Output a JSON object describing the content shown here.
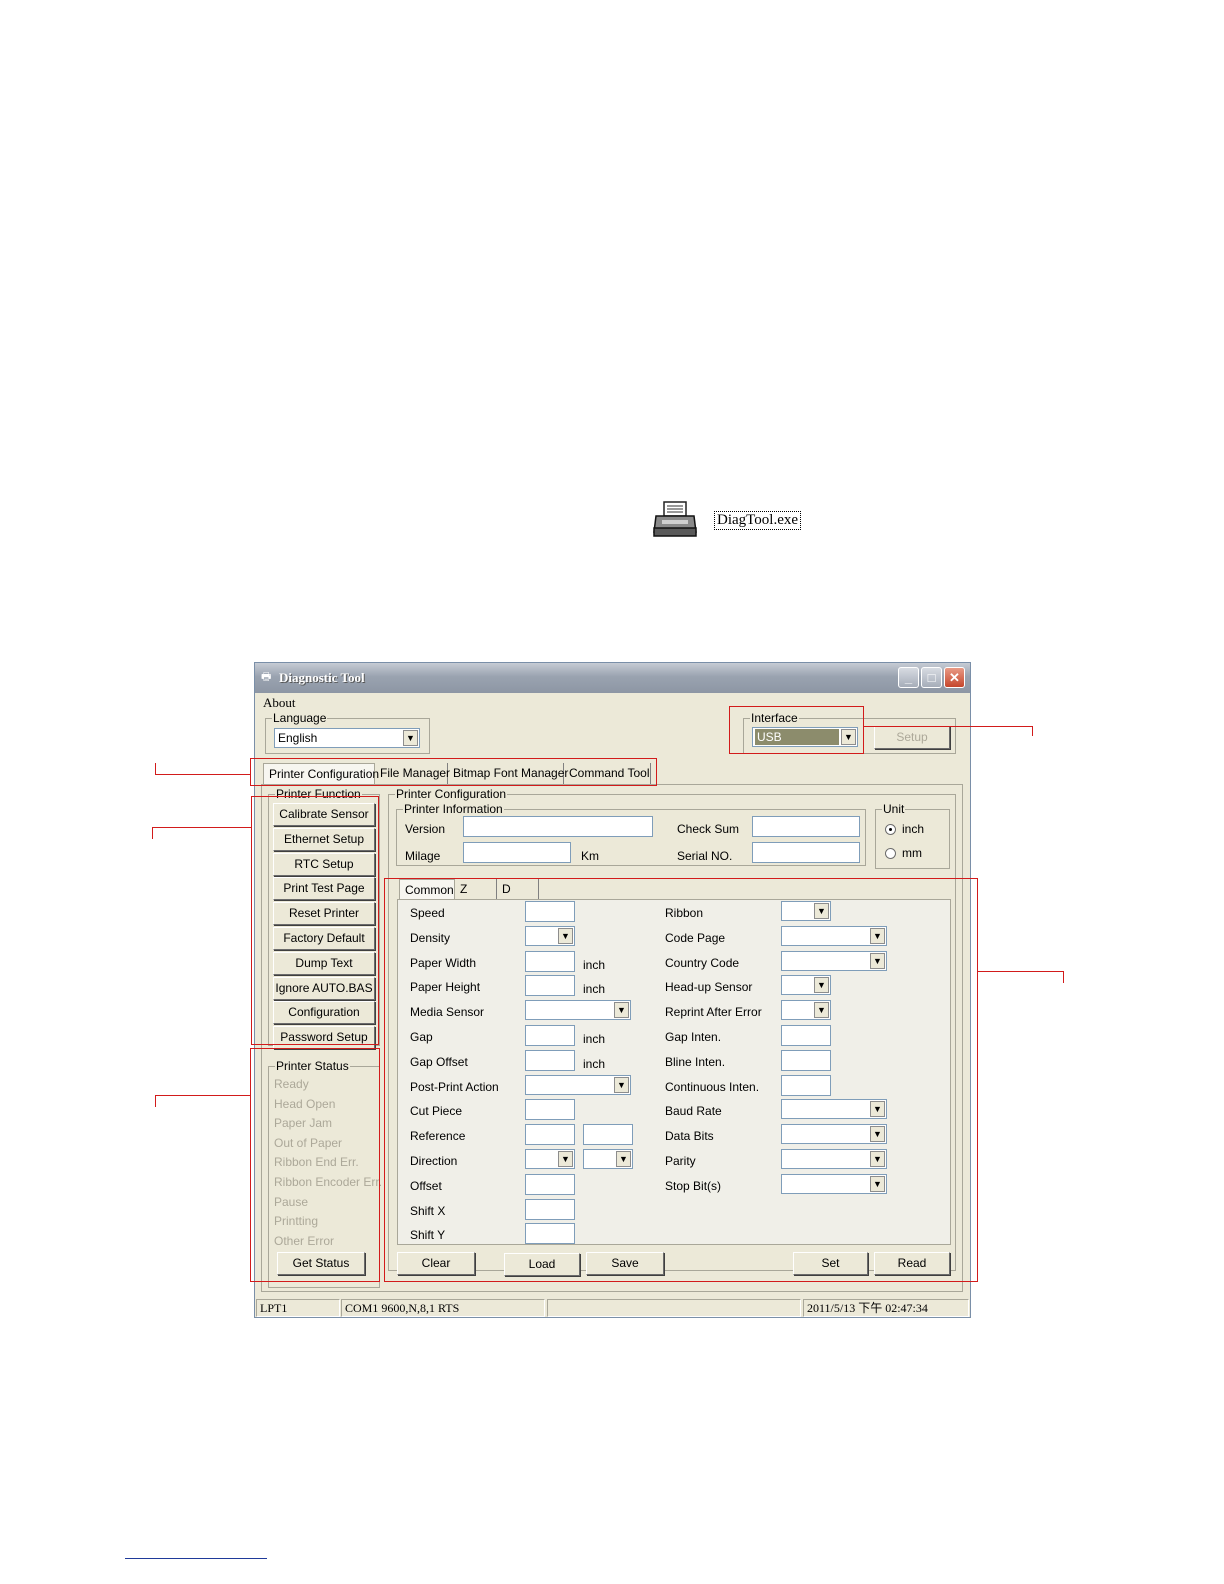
{
  "desktop_icon": {
    "label": "DiagTool.exe",
    "icon": "printer-icon"
  },
  "window": {
    "title": "Diagnostic Tool",
    "menu": [
      "About"
    ],
    "language": {
      "label": "Language",
      "value": "English"
    },
    "interface": {
      "label": "Interface",
      "value": "USB",
      "setup_label": "Setup"
    },
    "tabs": [
      "Printer Configuration",
      "File Manager",
      "Bitmap Font Manager",
      "Command Tool"
    ],
    "printer_function": {
      "label": "Printer Function",
      "buttons": [
        "Calibrate Sensor",
        "Ethernet Setup",
        "RTC Setup",
        "Print Test Page",
        "Reset Printer",
        "Factory Default",
        "Dump Text",
        "Ignore AUTO.BAS",
        "Configuration Page",
        "Password Setup"
      ]
    },
    "printer_status": {
      "label": "Printer Status",
      "items": [
        "Ready",
        "Head Open",
        "Paper Jam",
        "Out of Paper",
        "Ribbon End Err.",
        "Ribbon Encoder Err.",
        "Pause",
        "Printting",
        "Other Error"
      ],
      "get_status_label": "Get Status"
    },
    "printer_configuration": {
      "label": "Printer Configuration",
      "info_label": "Printer Information",
      "version_label": "Version",
      "checksum_label": "Check Sum",
      "milage_label": "Milage",
      "km_label": "Km",
      "serial_label": "Serial NO.",
      "unit": {
        "label": "Unit",
        "options": [
          "inch",
          "mm"
        ],
        "selected": "inch"
      }
    },
    "sub_tabs": [
      "Common",
      "Z",
      "D"
    ],
    "left_fields": [
      "Speed",
      "Density",
      "Paper Width",
      "Paper Height",
      "Media Sensor",
      "Gap",
      "Gap Offset",
      "Post-Print Action",
      "Cut Piece",
      "Reference",
      "Direction",
      "Offset",
      "Shift X",
      "Shift Y"
    ],
    "right_fields": [
      "Ribbon",
      "Code Page",
      "Country Code",
      "Head-up Sensor",
      "Reprint After Error",
      "Gap Inten.",
      "Bline Inten.",
      "Continuous Inten.",
      "Baud Rate",
      "Data Bits",
      "Parity",
      "Stop Bit(s)"
    ],
    "unit_suffix": "inch",
    "bottom_buttons": {
      "clear": "Clear",
      "load": "Load",
      "save": "Save",
      "set": "Set",
      "read": "Read"
    },
    "statusbar": {
      "lpt": "LPT1",
      "com": "COM1 9600,N,8,1 RTS",
      "empty": "",
      "datetime": "2011/5/13 下午 02:47:34"
    }
  }
}
